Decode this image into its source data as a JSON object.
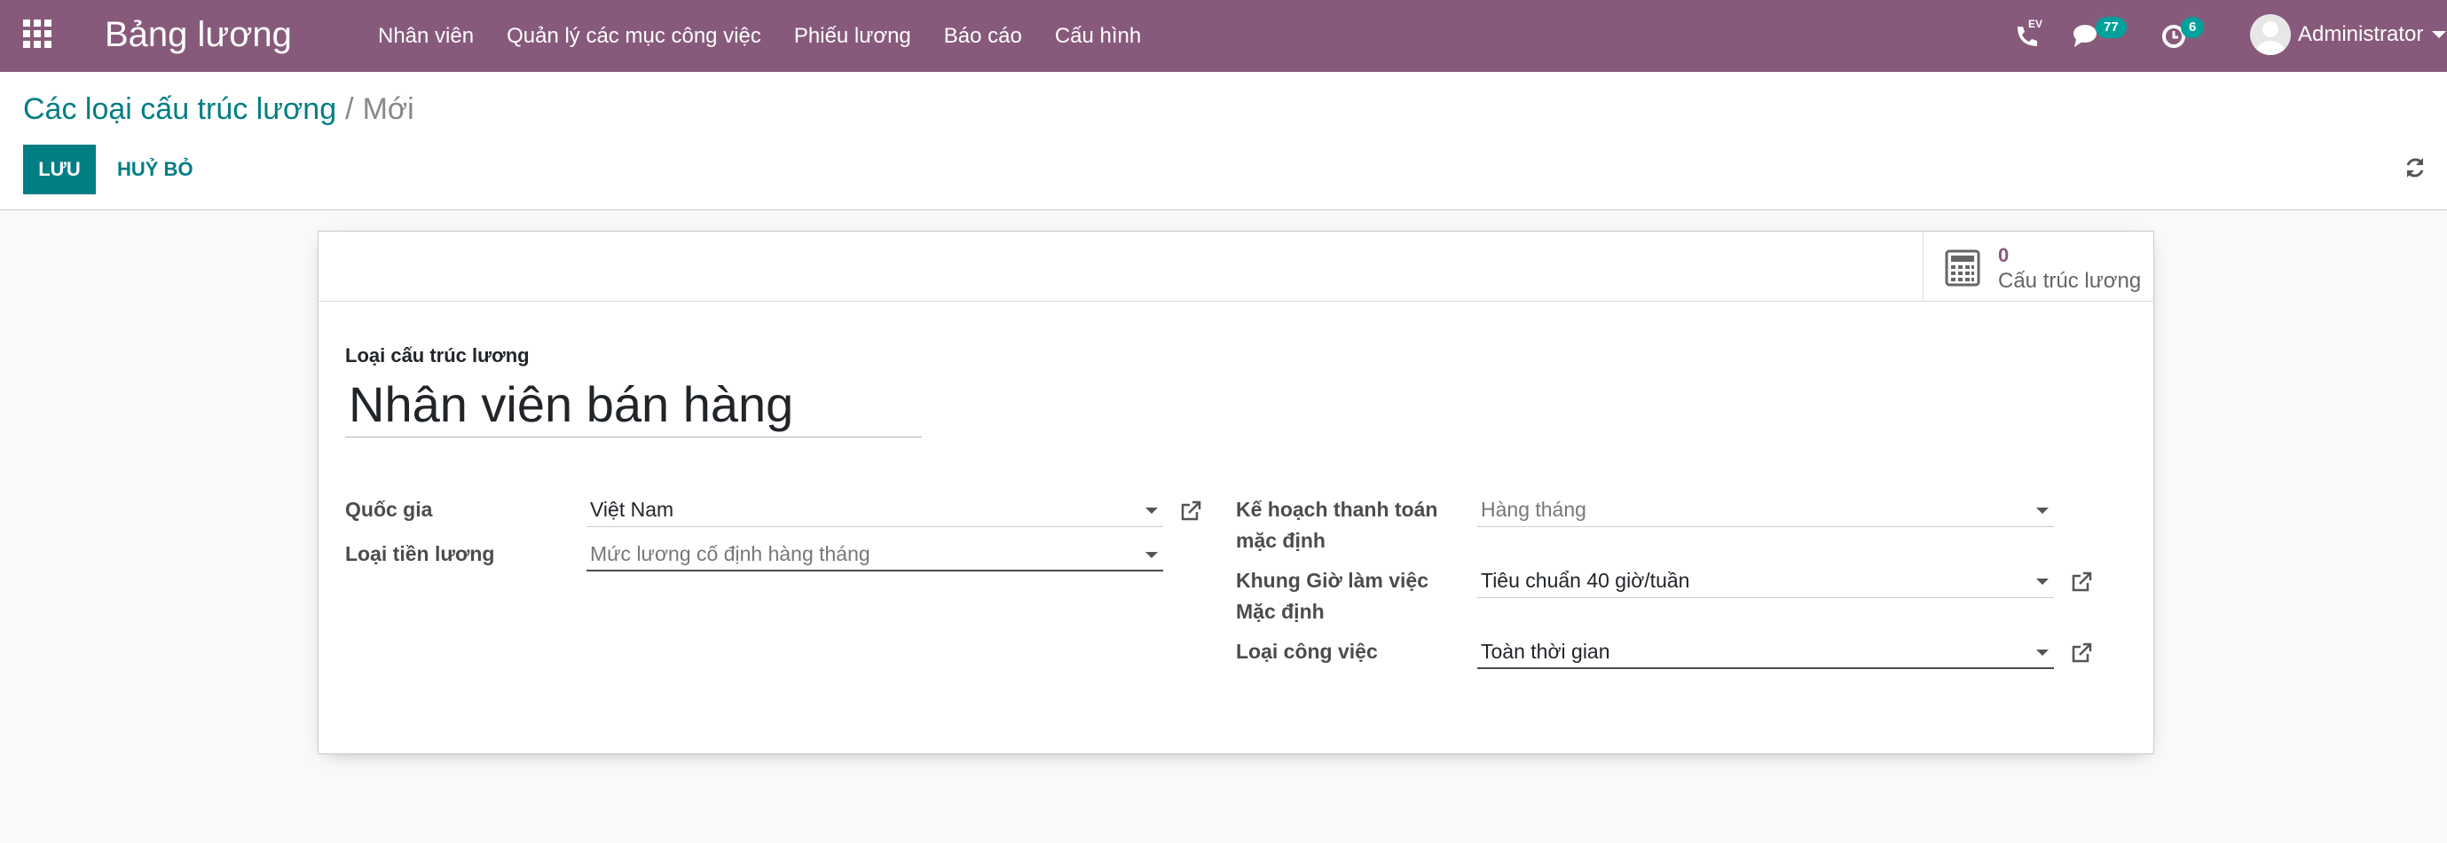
{
  "app": {
    "title": "Bảng lương"
  },
  "menu": [
    {
      "label": "Nhân viên"
    },
    {
      "label": "Quản lý các mục công việc"
    },
    {
      "label": "Phiếu lương"
    },
    {
      "label": "Báo cáo"
    },
    {
      "label": "Cấu hình"
    }
  ],
  "systray": {
    "phone_label": "EV",
    "messages_count": "77",
    "activities_count": "6",
    "user_name": "Administrator"
  },
  "breadcrumb": {
    "parent": "Các loại cấu trúc lương",
    "separator": "/",
    "current": "Mới"
  },
  "actions": {
    "save": "LƯU",
    "discard": "HUỶ BỎ"
  },
  "stat_button": {
    "value": "0",
    "label": "Cấu trúc lương"
  },
  "form": {
    "title_label": "Loại cấu trúc lương",
    "title_value": "Nhân viên bán hàng",
    "left": {
      "country": {
        "label": "Quốc gia",
        "value": "Việt Nam"
      },
      "wage_type": {
        "label": "Loại tiền lương",
        "value": "Mức lương cố định hàng tháng"
      }
    },
    "right": {
      "schedule_pay": {
        "label_line1": "Kế hoạch thanh toán",
        "label_line2": "mặc định",
        "value": "Hàng tháng"
      },
      "working_hours": {
        "label_line1": "Khung Giờ làm việc",
        "label_line2": "Mặc định",
        "value": "Tiêu chuẩn 40 giờ/tuần"
      },
      "job_type": {
        "label": "Loại công việc",
        "value": "Toàn thời gian"
      }
    }
  },
  "colors": {
    "navbar": "#875a7b",
    "primary": "#017e84",
    "badge": "#00a09d"
  }
}
